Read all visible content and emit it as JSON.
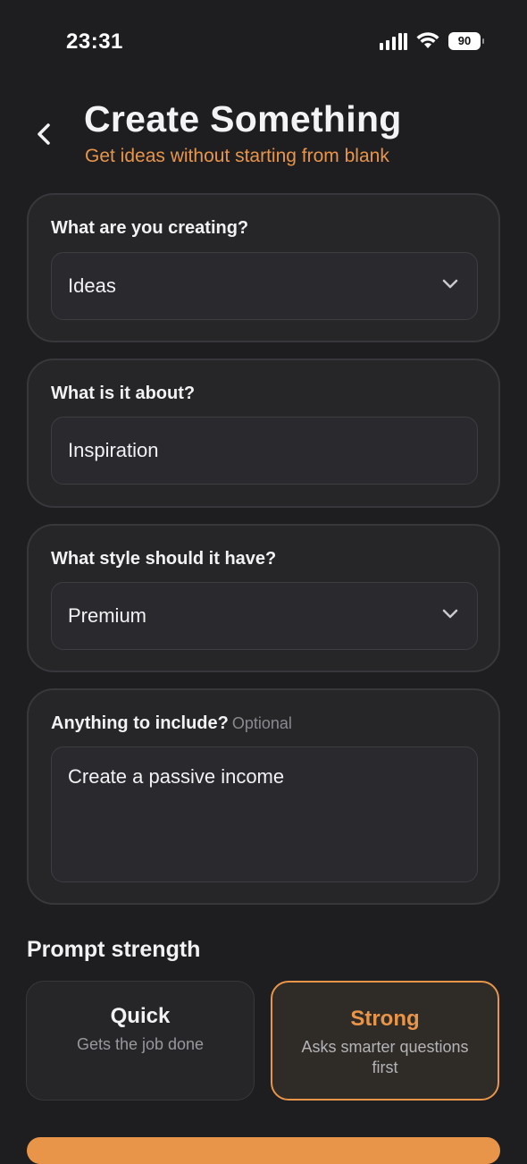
{
  "status_bar": {
    "time": "23:31",
    "battery": "90"
  },
  "header": {
    "title": "Create Something",
    "subtitle": "Get ideas without starting from blank"
  },
  "form": {
    "creating": {
      "label": "What are you creating?",
      "value": "Ideas"
    },
    "about": {
      "label": "What is it about?",
      "value": "Inspiration"
    },
    "style": {
      "label": "What style should it have?",
      "value": "Premium"
    },
    "include": {
      "label": "Anything to include?",
      "optional": "Optional",
      "value": "Create a passive income"
    }
  },
  "prompt_strength": {
    "title": "Prompt strength",
    "options": [
      {
        "title": "Quick",
        "description": "Gets the job done"
      },
      {
        "title": "Strong",
        "description": "Asks smarter questions first"
      }
    ],
    "selected": "Strong"
  },
  "colors": {
    "background": "#1e1e21",
    "card": "#262629",
    "accent": "#e8954a"
  }
}
